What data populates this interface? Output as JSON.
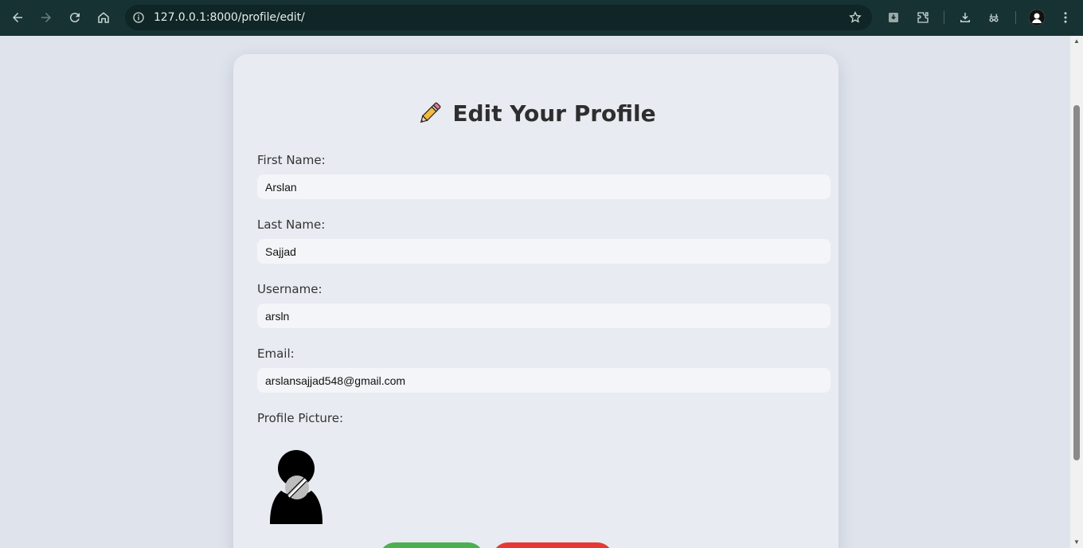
{
  "browser": {
    "url": "127.0.0.1:8000/profile/edit/"
  },
  "page": {
    "title": "Edit Your Profile",
    "fields": [
      {
        "label": "First Name:",
        "value": "Arslan"
      },
      {
        "label": "Last Name:",
        "value": "Sajjad"
      },
      {
        "label": "Username:",
        "value": "arsln"
      },
      {
        "label": "Email:",
        "value": "arslansajjad548@gmail.com"
      }
    ],
    "profile_picture_label": "Profile Picture:",
    "save_button_label": "",
    "cancel_button_label": ""
  },
  "colors": {
    "browser_bar": "#173233",
    "card_bg": "#e8ebf1",
    "save_button": "#4caf50",
    "cancel_button": "#e53935"
  },
  "icons": {
    "title_icon": "pencil-icon",
    "profile_picture": "user-silhouette-icon"
  }
}
